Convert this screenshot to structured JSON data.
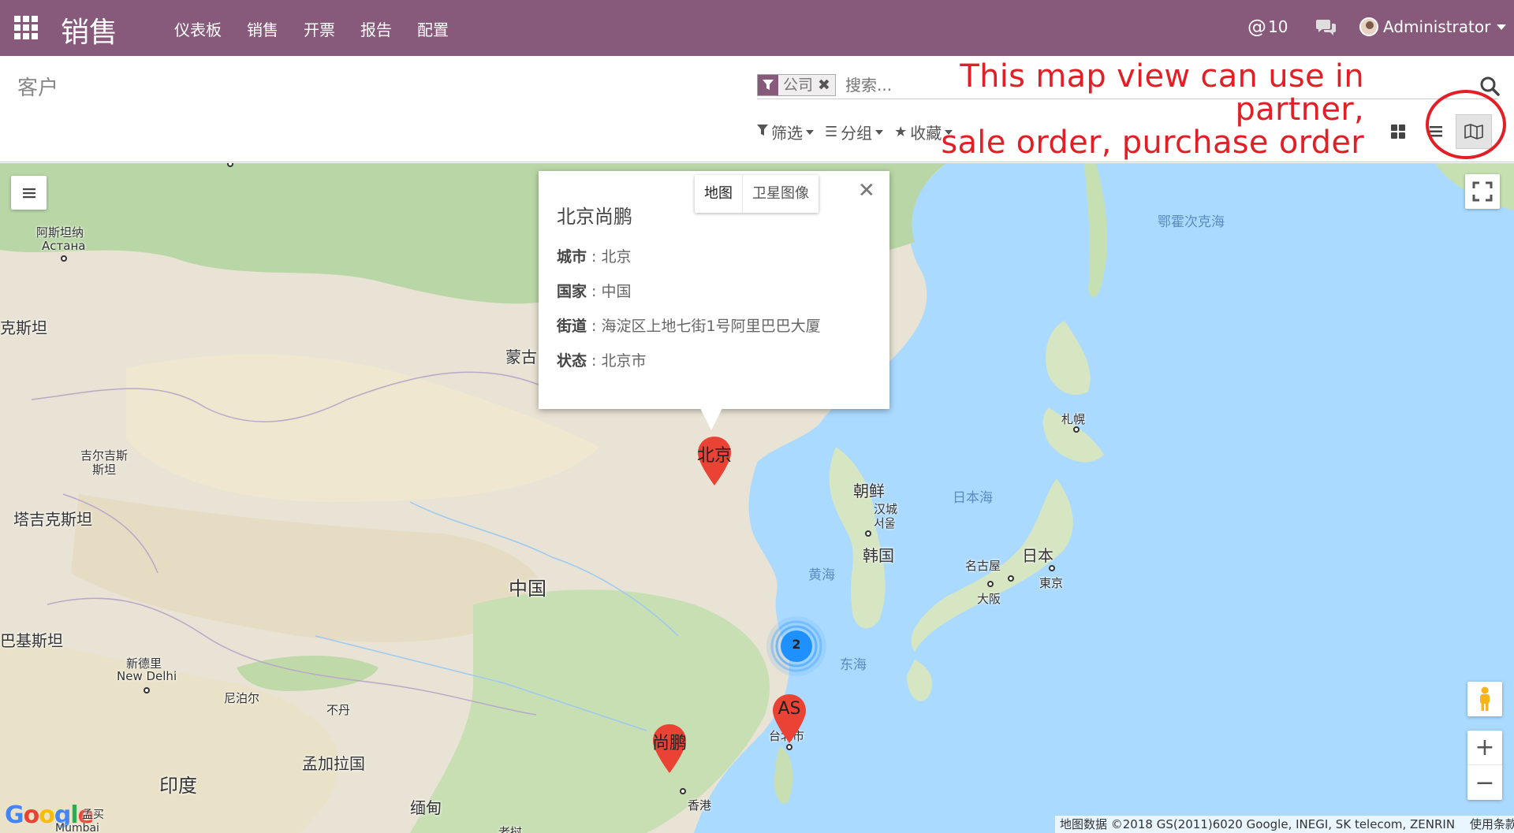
{
  "navbar": {
    "brand": "销售",
    "menu": [
      "仪表板",
      "销售",
      "开票",
      "报告",
      "配置"
    ],
    "mentions_count": "10",
    "user_name": "Administrator"
  },
  "control_panel": {
    "breadcrumb": "客户",
    "search": {
      "facet_label": "公司",
      "placeholder": "搜索..."
    },
    "filters": {
      "filter_label": "筛选",
      "group_label": "分组",
      "favorites_label": "收藏"
    },
    "annotation": "This map view can use in partner,\nsale order, purchase order"
  },
  "map": {
    "labels": {
      "astana_cn": "阿斯坦纳",
      "astana_ru": "Астана",
      "kazakhstan": "克斯坦",
      "mongolia": "蒙古",
      "kyrgyzstan": "吉尔吉斯\n斯坦",
      "tajikistan": "塔吉克斯坦",
      "pakistan": "巴基斯坦",
      "new_delhi_cn": "新德里",
      "new_delhi_en": "New Delhi",
      "nepal": "尼泊尔",
      "bhutan": "不丹",
      "bangladesh": "孟加拉国",
      "india": "印度",
      "myanmar": "缅甸",
      "laos": "老挝",
      "china": "中国",
      "beijing": "北京",
      "north_korea": "朝鲜",
      "seoul": "汉城\n서울",
      "south_korea": "韩国",
      "yellow_sea": "黄海",
      "east_sea": "东海",
      "sea_of_japan": "日本海",
      "okhotsk": "鄂霍次克海",
      "sapporo": "札幌",
      "japan": "日本",
      "nagoya": "名古屋",
      "osaka": "大阪",
      "tokyo": "東京",
      "taipei": "台北市",
      "hong_kong": "香港",
      "mumbai": "Mumbai",
      "mumbai_cn": "孟买"
    },
    "markers": [
      {
        "label": "北京"
      },
      {
        "label": "AS"
      },
      {
        "label": "尚鹏"
      }
    ],
    "cluster_count": "2",
    "popup": {
      "title": "北京尚鹏",
      "rows": [
        {
          "key": "城市",
          "value": "北京"
        },
        {
          "key": "国家",
          "value": "中国"
        },
        {
          "key": "街道",
          "value": "海淀区上地七街1号阿里巴巴大厦"
        },
        {
          "key": "状态",
          "value": "北京市"
        }
      ]
    },
    "map_type": {
      "map": "地图",
      "satellite": "卫星图像"
    },
    "attribution": "地图数据 ©2018 GS(2011)6020 Google, INEGI, SK telecom, ZENRIN",
    "terms": "使用条款",
    "google_logo": "Google"
  },
  "colors": {
    "brand": "#875a7b",
    "annotation": "#e31e24",
    "marker": "#ea4335",
    "cluster": "#1e90ff",
    "water": "#aadaff"
  }
}
